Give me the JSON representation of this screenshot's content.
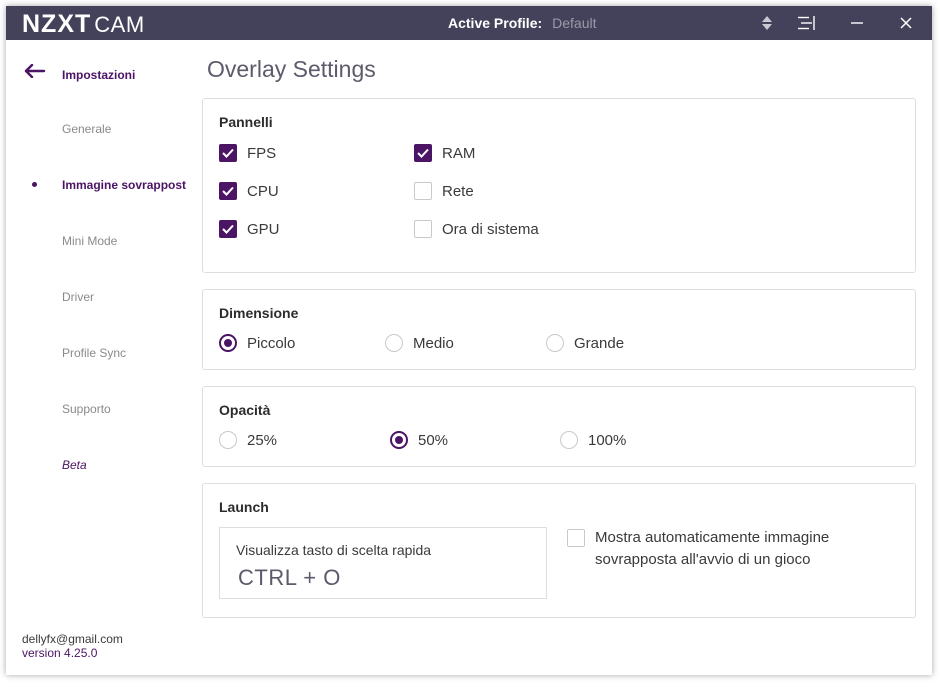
{
  "titlebar": {
    "logo_main": "NZXT",
    "logo_sub": "CAM",
    "profile_label": "Active Profile:",
    "profile_value": "Default",
    "icons": [
      "sort-arrows-icon",
      "menu-lines-icon",
      "minimize-icon",
      "close-icon"
    ]
  },
  "sidebar": {
    "title": "Impostazioni",
    "items": [
      {
        "label": "Generale"
      },
      {
        "label": "Immagine sovrapposta"
      },
      {
        "label": "Mini Mode"
      },
      {
        "label": "Driver"
      },
      {
        "label": "Profile Sync"
      },
      {
        "label": "Supporto"
      },
      {
        "label": "Beta"
      }
    ],
    "active_index": 1,
    "account_email": "dellyfx@gmail.com",
    "version": "version 4.25.0"
  },
  "page": {
    "title": "Overlay Settings"
  },
  "panels": {
    "title": "Pannelli",
    "options": [
      {
        "label": "FPS",
        "checked": true
      },
      {
        "label": "CPU",
        "checked": true
      },
      {
        "label": "GPU",
        "checked": true
      },
      {
        "label": "RAM",
        "checked": true
      },
      {
        "label": "Rete",
        "checked": false
      },
      {
        "label": "Ora di sistema",
        "checked": false
      }
    ]
  },
  "size": {
    "title": "Dimensione",
    "options": [
      {
        "label": "Piccolo",
        "selected": true
      },
      {
        "label": "Medio",
        "selected": false
      },
      {
        "label": "Grande",
        "selected": false
      }
    ]
  },
  "opacity": {
    "title": "Opacità",
    "options": [
      {
        "label": "25%",
        "selected": false
      },
      {
        "label": "50%",
        "selected": true
      },
      {
        "label": "100%",
        "selected": false
      }
    ]
  },
  "launch": {
    "title": "Launch",
    "hotkey_label": "Visualizza tasto di scelta rapida",
    "hotkey_value": "CTRL + O",
    "auto_show_label": "Mostra automaticamente immagine sovrapposta all'avvio di un gioco",
    "auto_show_checked": false
  },
  "colors": {
    "accent": "#4b1464",
    "titlebar": "#44425a"
  }
}
